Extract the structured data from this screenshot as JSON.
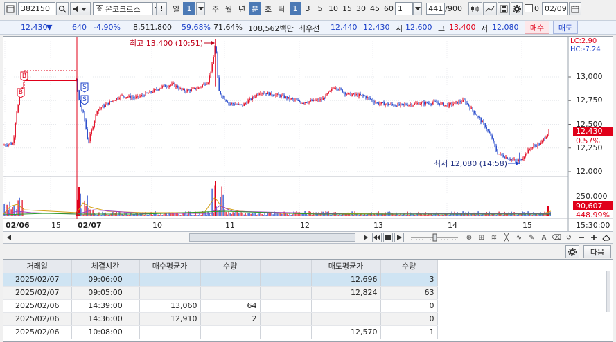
{
  "toolbar": {
    "stock_code": "382150",
    "stock_name": "온코크로스",
    "alert": "!",
    "period_day": "일",
    "period_day_value": "1",
    "period_week": "주",
    "period_month": "월",
    "period_year": "년",
    "period_minute": "분",
    "period_second": "초",
    "period_tick": "틱",
    "intervals": [
      "1",
      "3",
      "5",
      "10",
      "15",
      "30",
      "45",
      "60"
    ],
    "selected_interval": "1",
    "custom_interval": "1",
    "count": "441",
    "count_total": "/900",
    "checkbox_label": "0",
    "date": "02/09"
  },
  "quote": {
    "price": "12,430",
    "arrow": "▼",
    "change": "640",
    "change_pct": "-4.90%",
    "volume": "8,511,800",
    "ratio1": "59.68%",
    "ratio2": "71.64%",
    "amount": "108,562백만",
    "best_label": "최우선",
    "best_ask": "12,440",
    "best_bid": "12,430",
    "open_label": "시",
    "open": "12,600",
    "high_label": "고",
    "high": "13,400",
    "low_label": "저",
    "low": "12,080",
    "buy_button": "매수",
    "sell_button": "매도"
  },
  "chart": {
    "lc_label": "LC:2.90",
    "hc_label": "HC:-7.24",
    "high_annotation": "최고 13,400 (10:51)",
    "low_annotation": "최저 12,080 (14:58)",
    "current_price_tag": "12,430",
    "current_pct_tag": "0.57%",
    "volume_tag": "90,607",
    "volume_pct_tag": "448.99%",
    "time_label": "15:30:00",
    "price_ticks": [
      "13,000",
      "12,750",
      "12,500",
      "12,250",
      "12,000"
    ],
    "volume_ticks": [
      "250,000"
    ],
    "x_labels": [
      "02/06",
      "15",
      "02/07",
      "10",
      "11",
      "12",
      "13",
      "14",
      "15"
    ],
    "buy_marker": "B",
    "sell_marker": "S"
  },
  "colors": {
    "up": "#e0001a",
    "down": "#1a3fc8",
    "accent": "#4b79b5"
  },
  "panel": {
    "gear_icon": "gear-icon",
    "next_button": "다음"
  },
  "table": {
    "headers": [
      "거래일",
      "체결시간",
      "매수평균가",
      "수량",
      "",
      "매도평균가",
      "수량"
    ],
    "rows": [
      [
        "2025/02/07",
        "09:06:00",
        "",
        "",
        "",
        "12,696",
        "3"
      ],
      [
        "2025/02/07",
        "09:05:00",
        "",
        "",
        "",
        "12,824",
        "63"
      ],
      [
        "2025/02/06",
        "14:39:00",
        "13,060",
        "64",
        "",
        "",
        "0"
      ],
      [
        "2025/02/06",
        "14:36:00",
        "12,910",
        "2",
        "",
        "",
        "0"
      ],
      [
        "2025/02/06",
        "10:08:00",
        "",
        "",
        "",
        "12,570",
        "1"
      ]
    ]
  }
}
